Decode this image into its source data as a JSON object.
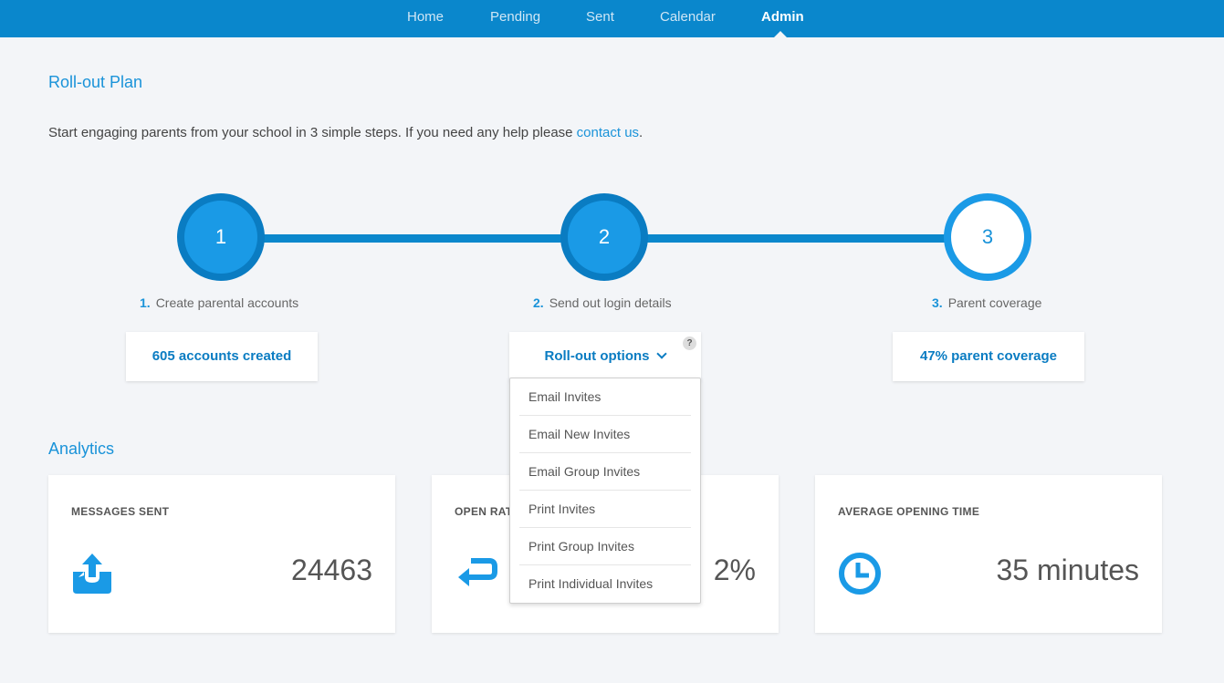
{
  "nav": {
    "items": [
      {
        "label": "Home"
      },
      {
        "label": "Pending"
      },
      {
        "label": "Sent"
      },
      {
        "label": "Calendar"
      },
      {
        "label": "Admin"
      }
    ],
    "active": "Admin"
  },
  "rollout": {
    "title": "Roll-out Plan",
    "intro_text": "Start engaging parents from your school in 3 simple steps. If you need any help please ",
    "contact_link": "contact us",
    "intro_end": ".",
    "steps": [
      {
        "number": "1",
        "index_label": "1.",
        "label": "Create parental accounts",
        "status": "done",
        "action": "605 accounts created"
      },
      {
        "number": "2",
        "index_label": "2.",
        "label": "Send out login details",
        "status": "done",
        "action": "Roll-out options"
      },
      {
        "number": "3",
        "index_label": "3.",
        "label": "Parent coverage",
        "status": "todo",
        "action": "47% parent coverage"
      }
    ],
    "help_badge": "?"
  },
  "dropdown": {
    "items": [
      "Email Invites",
      "Email New Invites",
      "Email Group Invites",
      "Print Invites",
      "Print Group Invites",
      "Print Individual Invites"
    ]
  },
  "analytics": {
    "title": "Analytics",
    "cards": [
      {
        "title": "MESSAGES SENT",
        "value": "24463",
        "icon": "upload-icon"
      },
      {
        "title": "OPEN RAT",
        "value": "2%",
        "icon": "return-arrow-icon"
      },
      {
        "title": "AVERAGE OPENING TIME",
        "value": "35 minutes",
        "icon": "clock-icon"
      }
    ]
  },
  "colors": {
    "brand": "#0a87cc",
    "accent": "#1a93d9",
    "background": "#f3f5f8"
  }
}
